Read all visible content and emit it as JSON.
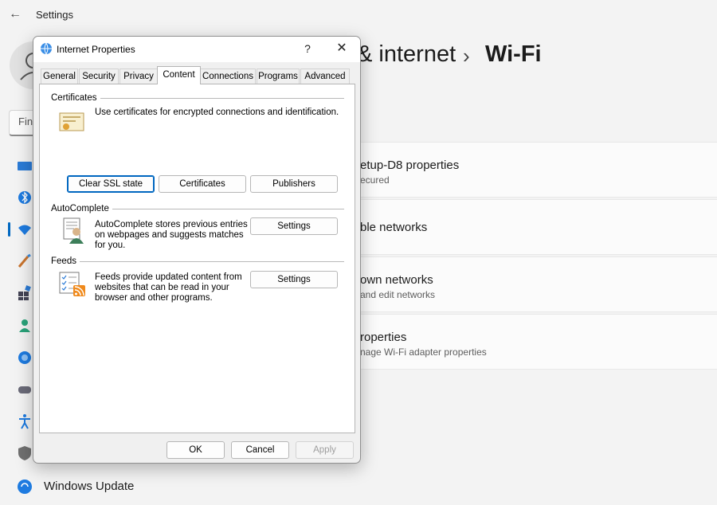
{
  "settings": {
    "window_title": "Settings",
    "search_placeholder": "Find",
    "breadcrumb_parent": "& internet",
    "breadcrumb_separator": "›",
    "breadcrumb_current": "Wi-Fi",
    "sidebar_bottom_label": "Windows Update",
    "cards": [
      {
        "title": "etup-D8 properties",
        "subtitle": "ecured"
      },
      {
        "title": "ble networks",
        "subtitle": ""
      },
      {
        "title": "own networks",
        "subtitle": "and edit networks"
      },
      {
        "title": "roperties",
        "subtitle": "nage Wi-Fi adapter properties"
      }
    ],
    "accent_color": "#0067c0"
  },
  "dialog": {
    "title": "Internet Properties",
    "help_label": "?",
    "close_label": "✕",
    "tabs": [
      "General",
      "Security",
      "Privacy",
      "Content",
      "Connections",
      "Programs",
      "Advanced"
    ],
    "active_tab": "Content",
    "certificates": {
      "group_label": "Certificates",
      "description": "Use certificates for encrypted connections and identification.",
      "buttons": [
        "Clear SSL state",
        "Certificates",
        "Publishers"
      ]
    },
    "autocomplete": {
      "group_label": "AutoComplete",
      "description_lines": [
        "AutoComplete stores previous entries",
        "on webpages and suggests matches",
        "for you."
      ],
      "settings_label": "Settings"
    },
    "feeds": {
      "group_label": "Feeds",
      "description_lines": [
        "Feeds provide updated content from",
        "websites that can be read in your",
        "browser and other programs."
      ],
      "settings_label": "Settings"
    },
    "footer": {
      "ok": "OK",
      "cancel": "Cancel",
      "apply": "Apply"
    }
  }
}
